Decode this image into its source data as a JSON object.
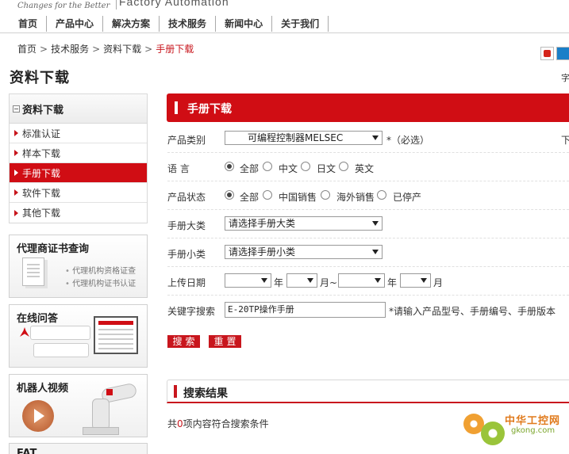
{
  "header": {
    "tagline": "Changes for the Better",
    "brand_tail": "Factory Automation",
    "nav": [
      "首页",
      "产品中心",
      "解决方案",
      "技术服务",
      "新闻中心",
      "关于我们"
    ]
  },
  "breadcrumb": {
    "items": [
      "首页",
      "技术服务",
      "资料下载"
    ],
    "separator": ">",
    "current": "手册下载"
  },
  "page_title": "资料下载",
  "page_title_right": "字",
  "sidebar": {
    "title": "资料下载",
    "items": [
      "标准认证",
      "样本下载",
      "手册下载",
      "软件下载",
      "其他下载"
    ],
    "active_index": 2
  },
  "promos": {
    "agent": {
      "title": "代理商证书查询",
      "lines": [
        "代理机构资格证查",
        "代理机构证书认证"
      ]
    },
    "qa": {
      "title": "在线问答"
    },
    "robot": {
      "title": "机器人视频"
    },
    "fat": {
      "title": "FAT"
    }
  },
  "section_title": "手册下载",
  "form": {
    "category": {
      "label": "产品类别",
      "value": "可编程控制器MELSEC",
      "note": "*（必选）",
      "right_text": "下"
    },
    "language": {
      "label": "语 言",
      "options": [
        "全部",
        "中文",
        "日文",
        "英文"
      ],
      "selected": 0
    },
    "status": {
      "label": "产品状态",
      "options": [
        "全部",
        "中国销售",
        "海外销售",
        "已停产"
      ],
      "selected": 0
    },
    "major": {
      "label": "手册大类",
      "value": "请选择手册大类"
    },
    "minor": {
      "label": "手册小类",
      "value": "请选择手册小类"
    },
    "date": {
      "label": "上传日期",
      "year1_unit": "年",
      "month1_unit": "月~",
      "year2_unit": "年",
      "month2_unit": "月"
    },
    "keyword": {
      "label": "关键字搜索",
      "value": "E-20TP操作手册",
      "note": "*请输入产品型号、手册编号、手册版本"
    },
    "search_label": "搜索",
    "reset_label": "重置"
  },
  "results": {
    "title": "搜索结果",
    "prefix": "共",
    "count": "0",
    "suffix": "项内容符合搜索条件"
  },
  "watermark": {
    "cn": "中华工控网",
    "en": "gkong.com"
  },
  "colors": {
    "accent": "#d00d14",
    "brand_red": "#c8161d"
  }
}
